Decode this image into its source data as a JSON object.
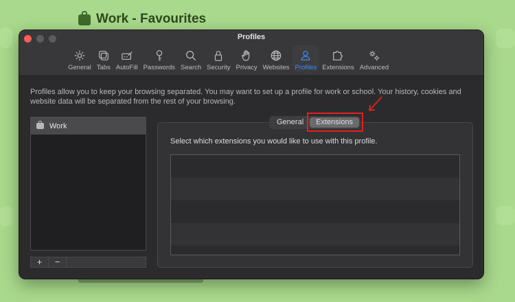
{
  "background": {
    "title": "Work - Favourites"
  },
  "window": {
    "title": "Profiles",
    "toolbar": [
      {
        "label": "General",
        "icon": "gear-icon"
      },
      {
        "label": "Tabs",
        "icon": "tabs-icon"
      },
      {
        "label": "AutoFill",
        "icon": "autofill-icon"
      },
      {
        "label": "Passwords",
        "icon": "key-icon"
      },
      {
        "label": "Search",
        "icon": "search-icon"
      },
      {
        "label": "Security",
        "icon": "lock-icon"
      },
      {
        "label": "Privacy",
        "icon": "hand-icon"
      },
      {
        "label": "Websites",
        "icon": "globe-icon"
      },
      {
        "label": "Profiles",
        "icon": "person-icon",
        "active": true
      },
      {
        "label": "Extensions",
        "icon": "puzzle-icon"
      },
      {
        "label": "Advanced",
        "icon": "gears-icon"
      }
    ],
    "accent_color": "#3b8cf7"
  },
  "content": {
    "description": "Profiles allow you to keep your browsing separated. You may want to set up a profile for work or school. Your history, cookies and website data will be separated from the rest of your browsing.",
    "profiles": [
      {
        "name": "Work",
        "selected": true
      }
    ],
    "add_label": "+",
    "remove_label": "−",
    "segments": {
      "general": "General",
      "extensions": "Extensions",
      "selected": "Extensions"
    },
    "extensions_prompt": "Select which extensions you would like to use with this profile."
  }
}
